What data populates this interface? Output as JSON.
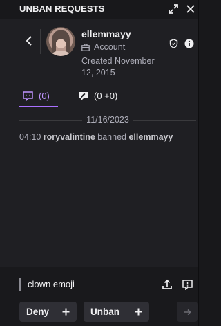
{
  "header": {
    "title": "UNBAN REQUESTS",
    "expand_icon": "expand-icon",
    "close_icon": "close-icon"
  },
  "user": {
    "username": "ellemmayy",
    "account_label": "Account",
    "created": "Created November 12, 2015"
  },
  "tabs": [
    {
      "label": "(0)",
      "icon": "chat-icon",
      "active": true
    },
    {
      "label": "(0 +0)",
      "icon": "mod-comment-icon",
      "active": false
    }
  ],
  "log": {
    "date": "11/16/2023",
    "time": "04:10",
    "moderator": "roryvalintine",
    "action": "banned",
    "target": "ellemmayy"
  },
  "request": {
    "text": "clown emoji"
  },
  "actions": {
    "deny_label": "Deny",
    "unban_label": "Unban"
  },
  "colors": {
    "accent": "#a970ff",
    "background": "#1f1f23"
  }
}
